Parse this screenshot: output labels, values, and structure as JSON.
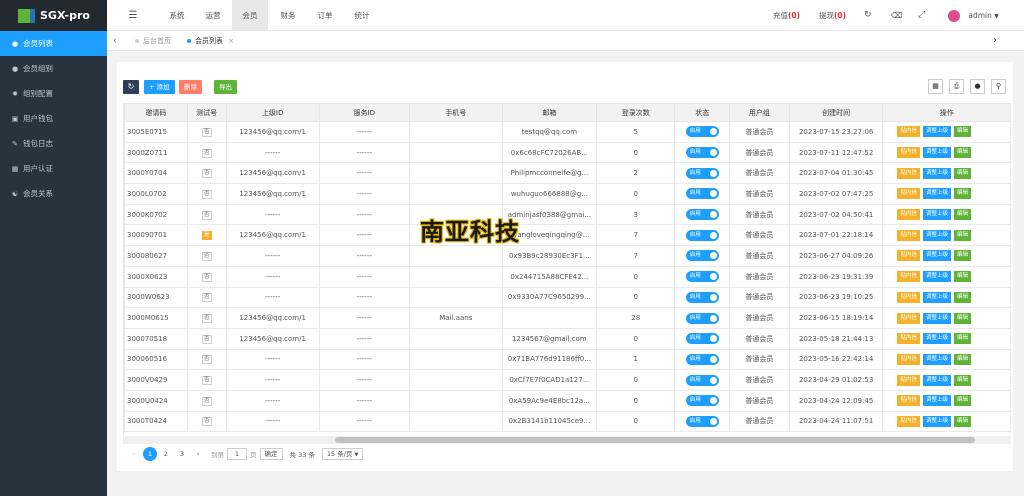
{
  "app": {
    "name": "SGX-pro"
  },
  "sidebar": {
    "items": [
      {
        "label": "会员列表",
        "icon": "user-icon",
        "active": true
      },
      {
        "label": "会员组别",
        "icon": "user-group-icon"
      },
      {
        "label": "组别配置",
        "icon": "gear-icon"
      },
      {
        "label": "用户钱包",
        "icon": "wallet-icon"
      },
      {
        "label": "钱包日志",
        "icon": "log-icon"
      },
      {
        "label": "用户认证",
        "icon": "id-card-icon"
      },
      {
        "label": "会员关系",
        "icon": "relation-icon"
      }
    ]
  },
  "topnav": {
    "toggle_icon": "menu-toggle-icon",
    "items": [
      "系统",
      "运营",
      "会员",
      "财务",
      "订单",
      "统计"
    ],
    "active": "会员",
    "recharge_label": "充值",
    "recharge_count": "(0)",
    "withdraw_label": "提现",
    "withdraw_count": "(0)",
    "username": "admin"
  },
  "tabs": {
    "home": "后台首页",
    "current": "会员列表"
  },
  "toolbar": {
    "refresh_icon": "refresh-icon",
    "add": "+ 添加",
    "delete": "删除",
    "export": "导出"
  },
  "table": {
    "columns": [
      "邀请码",
      "测试号",
      "上级ID",
      "服务ID",
      "手机号",
      "邮箱",
      "登录次数",
      "状态",
      "用户组",
      "创建时间",
      "操作"
    ],
    "rows": [
      {
        "code": "3005E0715",
        "test": "否",
        "parent": "123456@qq.com/1",
        "service": "------",
        "phone": "",
        "email": "testqq@qq.com",
        "logins": "5",
        "status": "启用",
        "group": "普通会员",
        "created": "2023-07-15 23:27:06"
      },
      {
        "code": "3000Z0711",
        "test": "否",
        "parent": "------",
        "service": "------",
        "phone": "",
        "email": "0x6c68cFC72026AB...",
        "logins": "0",
        "status": "启用",
        "group": "普通会员",
        "created": "2023-07-11 12:47:52"
      },
      {
        "code": "3000Y0704",
        "test": "否",
        "parent": "123456@qq.com/1",
        "service": "------",
        "phone": "",
        "email": "Philipmcconneife@g...",
        "logins": "2",
        "status": "启用",
        "group": "普通会员",
        "created": "2023-07-04 01:30:45"
      },
      {
        "code": "3000L0702",
        "test": "否",
        "parent": "123456@qq.com/1",
        "service": "------",
        "phone": "",
        "email": "wuhuguo666888@g...",
        "logins": "0",
        "status": "启用",
        "group": "普通会员",
        "created": "2023-07-02 07:47:25"
      },
      {
        "code": "3000K0702",
        "test": "否",
        "parent": "------",
        "service": "------",
        "phone": "",
        "email": "adminjasf0388@gmai...",
        "logins": "3",
        "status": "启用",
        "group": "普通会员",
        "created": "2023-07-02 04:50:41"
      },
      {
        "code": "300090701",
        "test": "是",
        "parent": "123456@qq.com/1",
        "service": "------",
        "phone": "",
        "email": "liyangloveqingqing@...",
        "logins": "7",
        "status": "启用",
        "group": "普通会员",
        "created": "2023-07-01 22:18:14"
      },
      {
        "code": "300080627",
        "test": "否",
        "parent": "------",
        "service": "------",
        "phone": "",
        "email": "0x93B9c28930Ec3F1...",
        "logins": "7",
        "status": "启用",
        "group": "普通会员",
        "created": "2023-06-27 04:09:26"
      },
      {
        "code": "3000X0623",
        "test": "否",
        "parent": "------",
        "service": "------",
        "phone": "",
        "email": "0x244715A88CFE42...",
        "logins": "0",
        "status": "启用",
        "group": "普通会员",
        "created": "2023-06-23 19:31:39"
      },
      {
        "code": "3000W0623",
        "test": "否",
        "parent": "------",
        "service": "------",
        "phone": "",
        "email": "0x9330A77C9650299...",
        "logins": "0",
        "status": "启用",
        "group": "普通会员",
        "created": "2023-06-23 19:10:25"
      },
      {
        "code": "3000M0615",
        "test": "否",
        "parent": "123456@qq.com/1",
        "service": "------",
        "phone": "Mail.aans",
        "email": "",
        "logins": "28",
        "status": "启用",
        "group": "普通会员",
        "created": "2023-06-15 18:19:14"
      },
      {
        "code": "300070518",
        "test": "否",
        "parent": "123456@qq.com/1",
        "service": "------",
        "phone": "",
        "email": "1234567@gmail.com",
        "logins": "0",
        "status": "启用",
        "group": "普通会员",
        "created": "2023-05-18 21:44:13"
      },
      {
        "code": "300060516",
        "test": "否",
        "parent": "------",
        "service": "------",
        "phone": "",
        "email": "0x71BA776d91186ff0...",
        "logins": "1",
        "status": "启用",
        "group": "普通会员",
        "created": "2023-05-16 22:42:14"
      },
      {
        "code": "3000V0429",
        "test": "否",
        "parent": "------",
        "service": "------",
        "phone": "",
        "email": "0xCf7E7f0CAD1a127...",
        "logins": "0",
        "status": "启用",
        "group": "普通会员",
        "created": "2023-04-29 01:02:53"
      },
      {
        "code": "3000U0424",
        "test": "否",
        "parent": "------",
        "service": "------",
        "phone": "",
        "email": "0xA59Ac9e4E8bc12a...",
        "logins": "0",
        "status": "启用",
        "group": "普通会员",
        "created": "2023-04-24 12:09:45"
      },
      {
        "code": "3000T0424",
        "test": "否",
        "parent": "------",
        "service": "------",
        "phone": "",
        "email": "0x2B3141b11045ce9...",
        "logins": "0",
        "status": "启用",
        "group": "普通会员",
        "created": "2023-04-24 11:07:51"
      }
    ],
    "row_actions": [
      "贴内信",
      "调整上级",
      "编辑"
    ]
  },
  "pagination": {
    "pages": [
      "1",
      "2",
      "3"
    ],
    "current": "1",
    "goto_label": "到第",
    "goto_value": "1",
    "page_unit": "页",
    "confirm": "确定",
    "total": "共 33 条",
    "page_size": "15 条/页"
  },
  "watermark": {
    "text": "南亚科技"
  },
  "colors": {
    "sidebar": "#28333e",
    "accent": "#1e9fff",
    "green": "#5fb336",
    "orange": "#f5b12a",
    "red": "#ff5722"
  }
}
